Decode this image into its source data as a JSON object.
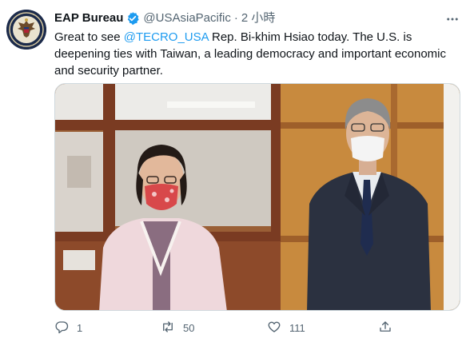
{
  "tweet": {
    "display_name": "EAP Bureau",
    "verified_icon": "verified-badge-icon",
    "handle": "@USAsiaPacific",
    "separator": "·",
    "time": "2 小時",
    "more_icon": "more-options-icon",
    "text_before": "Great to see ",
    "mention": "@TECRO_USA",
    "text_after": " Rep. Bi-khim Hsiao today. The U.S. is deepening ties with Taiwan, a leading democracy and important economic and security partner.",
    "photo_icon": "photo-of-two-officials",
    "avatar_icon": "state-department-seal-icon"
  },
  "actions": {
    "reply_count": "1",
    "retweet_count": "50",
    "like_count": "111",
    "reply_icon": "reply-icon",
    "retweet_icon": "retweet-icon",
    "like_icon": "like-icon",
    "share_icon": "share-icon"
  },
  "colors": {
    "accent": "#1d9bf0",
    "secondary_text": "#536471",
    "primary_text": "#0f1419"
  }
}
